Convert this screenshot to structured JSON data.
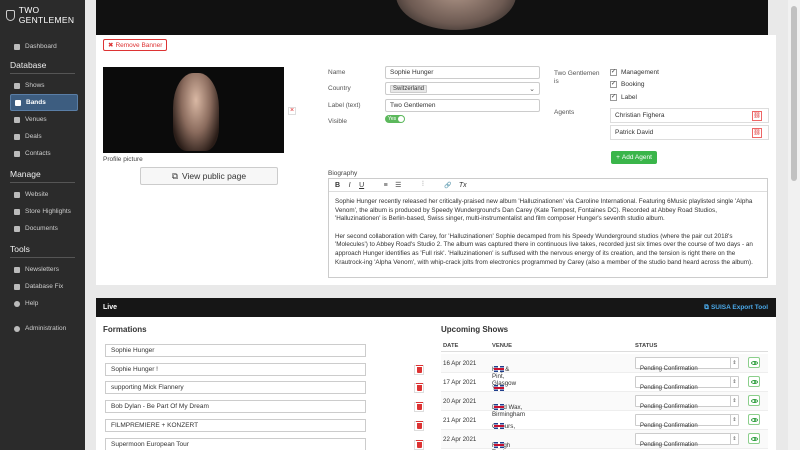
{
  "app": {
    "brand": "TWO GENTLEMEN"
  },
  "sidebar": {
    "dashboard": "Dashboard",
    "sections": [
      {
        "title": "Database",
        "items": [
          "Shows",
          "Bands",
          "Venues",
          "Deals",
          "Contacts"
        ]
      },
      {
        "title": "Manage",
        "items": [
          "Website",
          "Store Highlights",
          "Documents"
        ]
      },
      {
        "title": "Tools",
        "items": [
          "Newsletters",
          "Database Fix",
          "Help"
        ]
      }
    ],
    "administration": "Administration",
    "active": "Bands"
  },
  "banner": {
    "remove_label": "Remove Banner"
  },
  "profile": {
    "label": "Profile picture",
    "view_public": "View public page"
  },
  "form": {
    "name_label": "Name",
    "name_value": "Sophie Hunger",
    "country_label": "Country",
    "country_value": "Switzerland",
    "label_text_label": "Label (text)",
    "label_text_value": "Two Gentlemen",
    "visible_label": "Visible",
    "visible_value": "Yes"
  },
  "two_gentlemen": {
    "label": "Two Gentlemen is",
    "options": [
      {
        "label": "Management",
        "checked": true
      },
      {
        "label": "Booking",
        "checked": true
      },
      {
        "label": "Label",
        "checked": true
      }
    ]
  },
  "agents": {
    "label": "Agents",
    "list": [
      "Christian Fighera",
      "Patrick David"
    ],
    "add_label": "Add Agent"
  },
  "biography": {
    "label": "Biography",
    "toolbar": [
      "B",
      "I",
      "U",
      "≡",
      "☰",
      "⫶",
      "🔗",
      "Tx"
    ],
    "paragraphs": [
      "Sophie Hunger recently released her critically-praised new album 'Halluzinationen' via Caroline International. Featuring 6Music playlisted single 'Alpha Venom', the album is produced by Speedy Wunderground's Dan Carey (Kate Tempest, Fontaines DC). Recorded at Abbey Road Studios, 'Halluzinationen' is Berlin-based, Swiss singer, multi-instrumentalist and film composer Hunger's seventh studio album.",
      "Her second collaboration with Carey, for 'Halluzinationen' Sophie decamped from his Speedy Wunderground studios (where the pair cut 2018's 'Molecules') to Abbey Road's Studio 2. The album was captured there in continuous live takes, recorded just six times over the course of two days - an approach Hunger identifies as 'Full risk'. 'Halluzinationen' is suffused with the nervous energy of its creation, and the tension is right there on the Krautrock-ing 'Alpha Venom', with whip-crack jolts from electronics programmed by Carey (also a member of the studio band heard across the album)."
    ]
  },
  "live": {
    "title": "Live",
    "export_label": "SUISA Export Tool",
    "formations_title": "Formations",
    "formations": [
      "Sophie Hunger",
      "Sophie Hunger !",
      "supporting Mick Flannery",
      "Bob Dylan - Be Part Of My Dream",
      "FILMPREMIERE + KONZERT",
      "Supermoon European Tour"
    ],
    "shows_title": "Upcoming Shows",
    "shows_columns": [
      "DATE",
      "VENUE",
      "STATUS"
    ],
    "shows": [
      {
        "date": "16 Apr 2021",
        "venue": "Hug & Pint, Glasgow",
        "status": "Pending Confirmation"
      },
      {
        "date": "17 Apr 2021",
        "venue": "YES (Basement), Manchester",
        "status": "Pending Confirmation"
      },
      {
        "date": "20 Apr 2021",
        "venue": "Dead Wax, Birmingham",
        "status": "Pending Confirmation"
      },
      {
        "date": "21 Apr 2021",
        "venue": "Colours, London",
        "status": "Pending Confirmation"
      },
      {
        "date": "22 Apr 2021",
        "venue": "Rough Trade, Bristol",
        "status": "Pending Confirmation"
      }
    ]
  },
  "colors": {
    "accent": "#3d5d80",
    "danger": "#d33333",
    "success": "#3ab54a",
    "link": "#4aa8e8"
  }
}
